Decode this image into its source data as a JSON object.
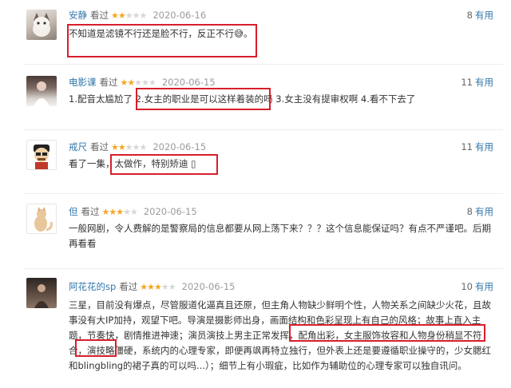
{
  "comments": [
    {
      "author": "安静",
      "watched": "看过",
      "rating": 2,
      "date": "2020-06-16",
      "votes": "8",
      "useful": "有用",
      "text": "不知道是滤镜不行还是脸不行，反正不行😅。"
    },
    {
      "author": "电影课",
      "watched": "看过",
      "rating": 2,
      "date": "2020-06-15",
      "votes": "11",
      "useful": "有用",
      "text": "1.配音太尴尬了 2.女主的职业是可以这样着装的吗 3.女主没有提审权啊 4.看不下去了"
    },
    {
      "author": "戒尺",
      "watched": "看过",
      "rating": 2,
      "date": "2020-06-15",
      "votes": "11",
      "useful": "有用",
      "text": "看了一集，太做作，特别矫迪 ▯"
    },
    {
      "author": "但",
      "watched": "看过",
      "rating": 3,
      "date": "2020-06-15",
      "votes": "8",
      "useful": "有用",
      "text": "一般网剧，令人费解的是警察局的信息都要从网上荡下来？？？这个信息能保证吗？有点不严谨吧。后期再看看"
    },
    {
      "author": "阿花花的sp",
      "watched": "看过",
      "rating": 3,
      "date": "2020-06-15",
      "votes": "10",
      "useful": "有用",
      "text": "三星，目前没有爆点，尽管服道化逼真且还原，但主角人物缺少鲜明个性，人物关系之间缺少火花，且故事没有大IP加持，观望下吧。导演是摄影师出身，画面结构和色彩呈现上有自己的风格；故事上直入主题，节奏快，剧情推进神速；演员演技上男主正常发挥，配角出彩，女主服饰妆容和人物身份稍显不符合，演技略僵硬，系统内的心理专家，即便再飒再特立独行，但外表上还是要遵循职业操守的，少女腮红和blingbling的裙子真的可以吗...）；细节上有小瑕疵，比如作为辅助位的心理专家可以独自讯问。"
    }
  ]
}
